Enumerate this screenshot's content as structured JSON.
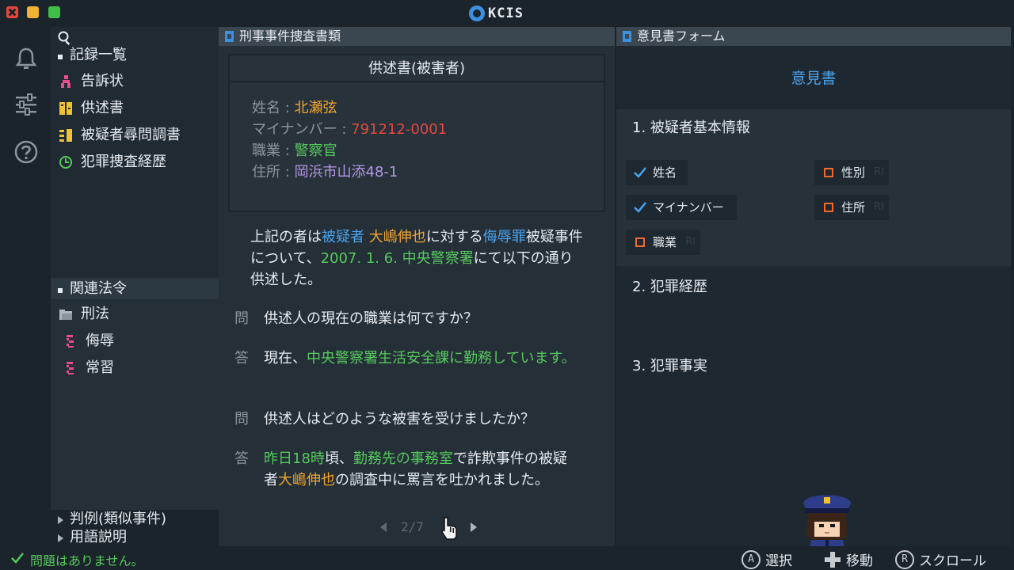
{
  "app": {
    "logo_text": "KCIS"
  },
  "tree": {
    "records_head": "記録一覧",
    "records": [
      {
        "label": "告訴状",
        "icon": "figure-icon"
      },
      {
        "label": "供述書",
        "icon": "statement-icon"
      },
      {
        "label": "被疑者尋問調書",
        "icon": "interrogation-icon"
      },
      {
        "label": "犯罪捜査経歴",
        "icon": "history-icon"
      }
    ],
    "law_head": "関連法令",
    "law_folder": "刑法",
    "laws": [
      "侮辱",
      "常習"
    ],
    "precedent_head": "判例(類似事件)",
    "glossary_head": "用語説明"
  },
  "doc": {
    "panel_title": "刑事事件捜査書類",
    "card_title": "供述書(被害者)",
    "info": {
      "name_label": "姓名 : ",
      "name_value": "北瀬弦",
      "mynumber_label": "マイナンバー : ",
      "mynumber_value": "791212-0001",
      "job_label": "職業 : ",
      "job_value": "警察官",
      "address_label": "住所 : ",
      "address_value": "岡浜市山添48-1"
    },
    "intro": {
      "p1": "上記の者は",
      "suspect_role": "被疑者",
      "suspect_name": "大嶋伸也",
      "p2": "に対する",
      "crime": "侮辱罪",
      "p3": "被疑事件について、",
      "date_place": "2007. 1. 6. 中央警察署",
      "p4": "にて以下の通り供述した。"
    },
    "q_mark": "問",
    "a_mark": "答",
    "q1": "供述人の現在の職業は何ですか？",
    "a1_prefix": "現在、",
    "a1_green": "中央警察署生活安全課に勤務しています。",
    "q2": "供述人はどのような被害を受けましたか？",
    "a2": {
      "time": "昨日18時",
      "t1": "頃、",
      "place": "勤務先の事務室",
      "t2": "で詐欺事件の被疑者",
      "name": "大嶋伸也",
      "t3": "の調査中に罵言を吐かれました。"
    },
    "pager": "2/7"
  },
  "form": {
    "panel_title": "意見書フォーム",
    "title": "意見書",
    "sec1": "1. 被疑者基本情報",
    "chips": [
      {
        "label": "姓名",
        "checked": true
      },
      {
        "label": "性別",
        "checked": false,
        "tag": "RI"
      },
      {
        "label": "マイナンバー",
        "checked": true
      },
      {
        "label": "住所",
        "checked": false,
        "tag": "RI"
      },
      {
        "label": "職業",
        "checked": false,
        "tag": "RI"
      }
    ],
    "sec2": "2. 犯罪経歴",
    "sec3": "3. 犯罪事実"
  },
  "status": {
    "message": "問題はありません。",
    "hint_a_glyph": "A",
    "hint_a": "選択",
    "hint_move": "移動",
    "hint_r_glyph": "R",
    "hint_r": "スクロール"
  },
  "colors": {
    "accent_blue": "#4aa3ee",
    "orange": "#f0a530",
    "red": "#e5483f",
    "green": "#57c95d",
    "purple": "#b497e6"
  }
}
